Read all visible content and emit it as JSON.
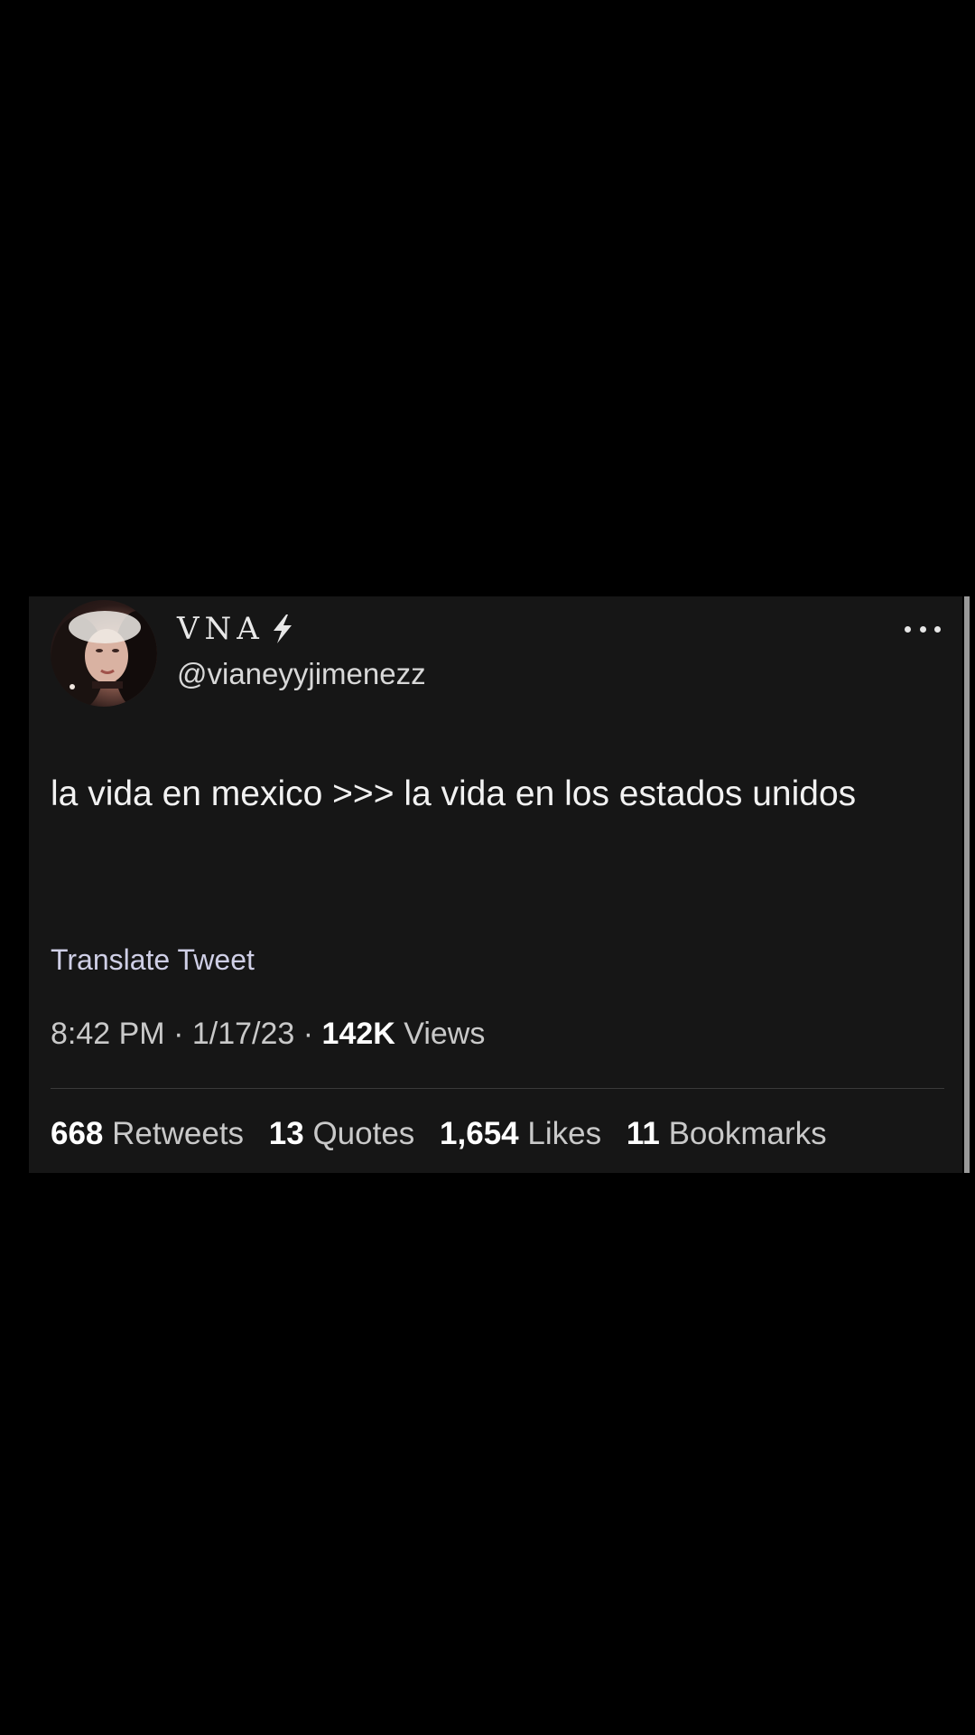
{
  "tweet": {
    "display_name": "VNA",
    "name_emoji_icon": "lightning-bolt-icon",
    "handle": "@vianeyyjimenezz",
    "more_icon": "more-options-icon",
    "text": "la vida en mexico >>> la vida en los estados unidos",
    "translate_label": "Translate Tweet",
    "time": "8:42 PM",
    "separator": "·",
    "date": "1/17/23",
    "views_count": "142K",
    "views_label": "Views",
    "stats": {
      "retweets_count": "668",
      "retweets_label": "Retweets",
      "quotes_count": "13",
      "quotes_label": "Quotes",
      "likes_count": "1,654",
      "likes_label": "Likes",
      "bookmarks_count": "11",
      "bookmarks_label": "Bookmarks"
    }
  },
  "colors": {
    "background": "#000000",
    "card": "#161616",
    "text_primary": "#f2f2f2",
    "text_secondary": "#c9c9c9",
    "bolt": "#e8e8e8"
  }
}
